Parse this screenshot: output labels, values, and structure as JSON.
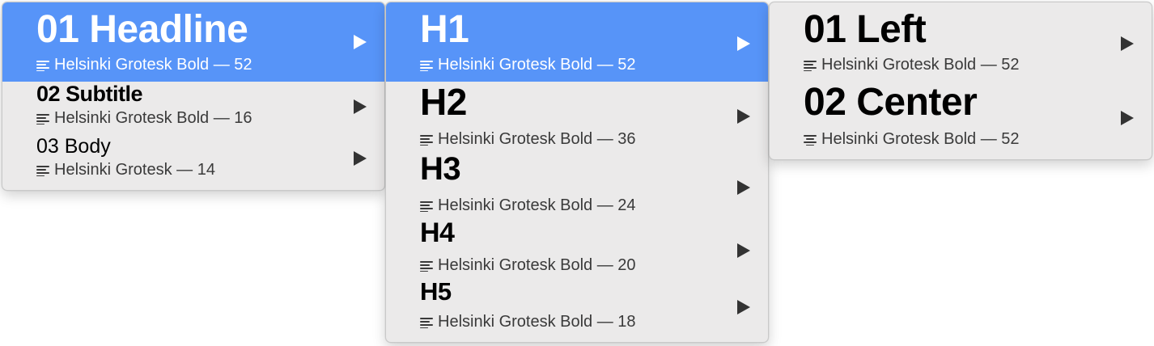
{
  "menus": [
    {
      "items": [
        {
          "title": "01 Headline",
          "subtitle": "Helsinki Grotesk Bold — 52",
          "selected": true
        },
        {
          "title": "02 Subtitle",
          "subtitle": "Helsinki Grotesk Bold — 16",
          "selected": false
        },
        {
          "title": "03 Body",
          "subtitle": "Helsinki Grotesk — 14",
          "selected": false
        }
      ]
    },
    {
      "items": [
        {
          "title": "H1",
          "subtitle": "Helsinki Grotesk Bold — 52",
          "selected": true
        },
        {
          "title": "H2",
          "subtitle": "Helsinki Grotesk Bold — 36",
          "selected": false
        },
        {
          "title": "H3",
          "subtitle": "Helsinki Grotesk Bold — 24",
          "selected": false
        },
        {
          "title": "H4",
          "subtitle": "Helsinki Grotesk Bold — 20",
          "selected": false
        },
        {
          "title": "H5",
          "subtitle": "Helsinki Grotesk Bold — 18",
          "selected": false
        }
      ]
    },
    {
      "items": [
        {
          "title": "01 Left",
          "subtitle": "Helsinki Grotesk Bold — 52",
          "selected": false,
          "icon": "align-left-icon"
        },
        {
          "title": "02 Center",
          "subtitle": "Helsinki Grotesk Bold — 52",
          "selected": false,
          "icon": "align-center-icon"
        }
      ]
    }
  ],
  "colors": {
    "selection": "#5794f8",
    "menu_background": "#ebeaea"
  }
}
